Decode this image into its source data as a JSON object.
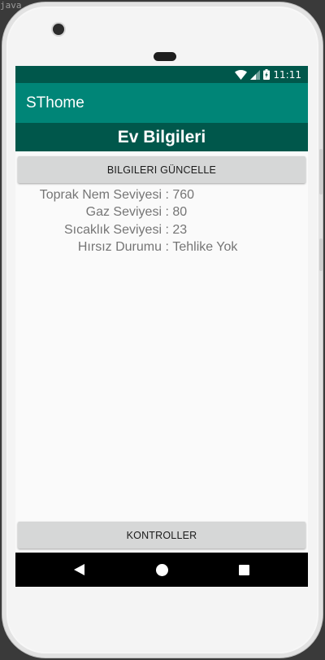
{
  "background": {
    "code_fragment": "java"
  },
  "status_bar": {
    "time": "11:11",
    "icons": [
      "wifi-icon",
      "signal-icon",
      "battery-icon"
    ]
  },
  "app_bar": {
    "title": "SThome"
  },
  "header": {
    "title": "Ev Bilgileri"
  },
  "buttons": {
    "update_label": "BILGILERI GÜNCELLE",
    "controls_label": "KONTROLLER"
  },
  "info": [
    {
      "label": "Toprak Nem Seviyesi",
      "separator": " : ",
      "value": "760"
    },
    {
      "label": "Gaz Seviyesi",
      "separator": " : ",
      "value": "80"
    },
    {
      "label": "Sıcaklık Seviyesi",
      "separator": " : ",
      "value": "23"
    },
    {
      "label": "Hırsız Durumu",
      "separator": " : ",
      "value": "Tehlike Yok"
    }
  ],
  "nav_bar": {
    "icons": [
      "back-icon",
      "home-icon",
      "recents-icon"
    ]
  },
  "colors": {
    "primary": "#008577",
    "primary_dark": "#00574b",
    "button": "#d6d7d7",
    "text_secondary": "#757575"
  }
}
